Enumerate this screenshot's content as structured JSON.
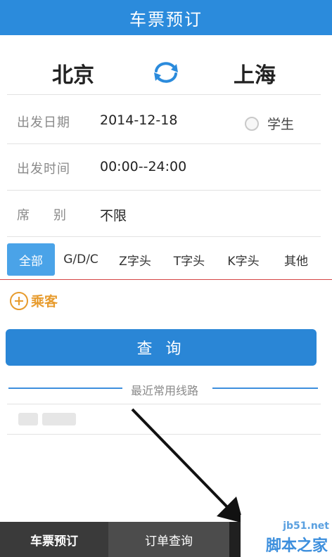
{
  "header": {
    "title": "车票预订"
  },
  "route": {
    "from": "北京",
    "to": "上海"
  },
  "form": {
    "date_label": "出发日期",
    "date_value": "2014-12-18",
    "student_label": "学生",
    "time_label": "出发时间",
    "time_value": "00:00--24:00",
    "seat_label_1": "席",
    "seat_label_2": "别",
    "seat_value": "不限"
  },
  "tabs": [
    "全部",
    "G/D/C",
    "Z字头",
    "T字头",
    "K字头",
    "其他"
  ],
  "passenger": {
    "label": "乘客"
  },
  "search_button": "查 询",
  "recent_routes": {
    "title": "最近常用线路"
  },
  "bottom_nav": {
    "booking": "车票预订",
    "orders": "订单查询"
  },
  "watermark": {
    "url": "jb51.net",
    "text": "脚本之家"
  },
  "colors": {
    "primary": "#2b8bdc",
    "accent": "#e79b2d"
  }
}
